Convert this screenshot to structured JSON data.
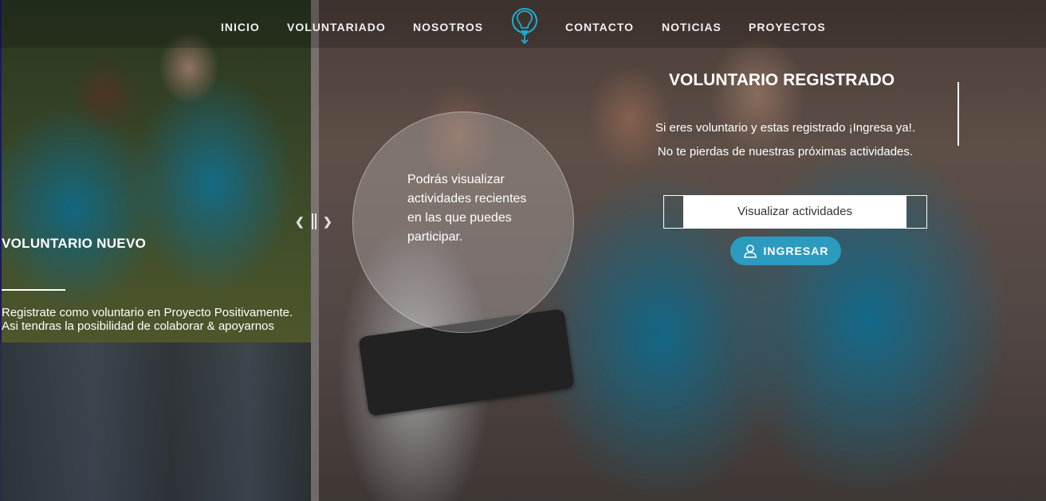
{
  "nav": {
    "items": [
      "INICIO",
      "VOLUNTARIADO",
      "NOSOTROS",
      "CONTACTO",
      "NOTICIAS",
      "PROYECTOS"
    ]
  },
  "left": {
    "title": "VOLUNTARIO NUEVO",
    "desc_line1": "Registrate como voluntario en Proyecto Positivamente.",
    "desc_line2": "Asi tendras la posibilidad de colaborar & apoyarnos"
  },
  "circle": {
    "text": "Podrás visualizar actividades recientes en las que puedes participar."
  },
  "right": {
    "title": "VOLUNTARIO REGISTRADO",
    "desc_line1": "Si eres voluntario y estas registrado ¡Ingresa ya!.",
    "desc_line2": "No te pierdas de nuestras próximas actividades.",
    "activities_label": "Visualizar actividades",
    "login_label": "INGRESAR"
  },
  "colors": {
    "accent": "#2b9bc0",
    "logo": "#1ab0d8"
  }
}
